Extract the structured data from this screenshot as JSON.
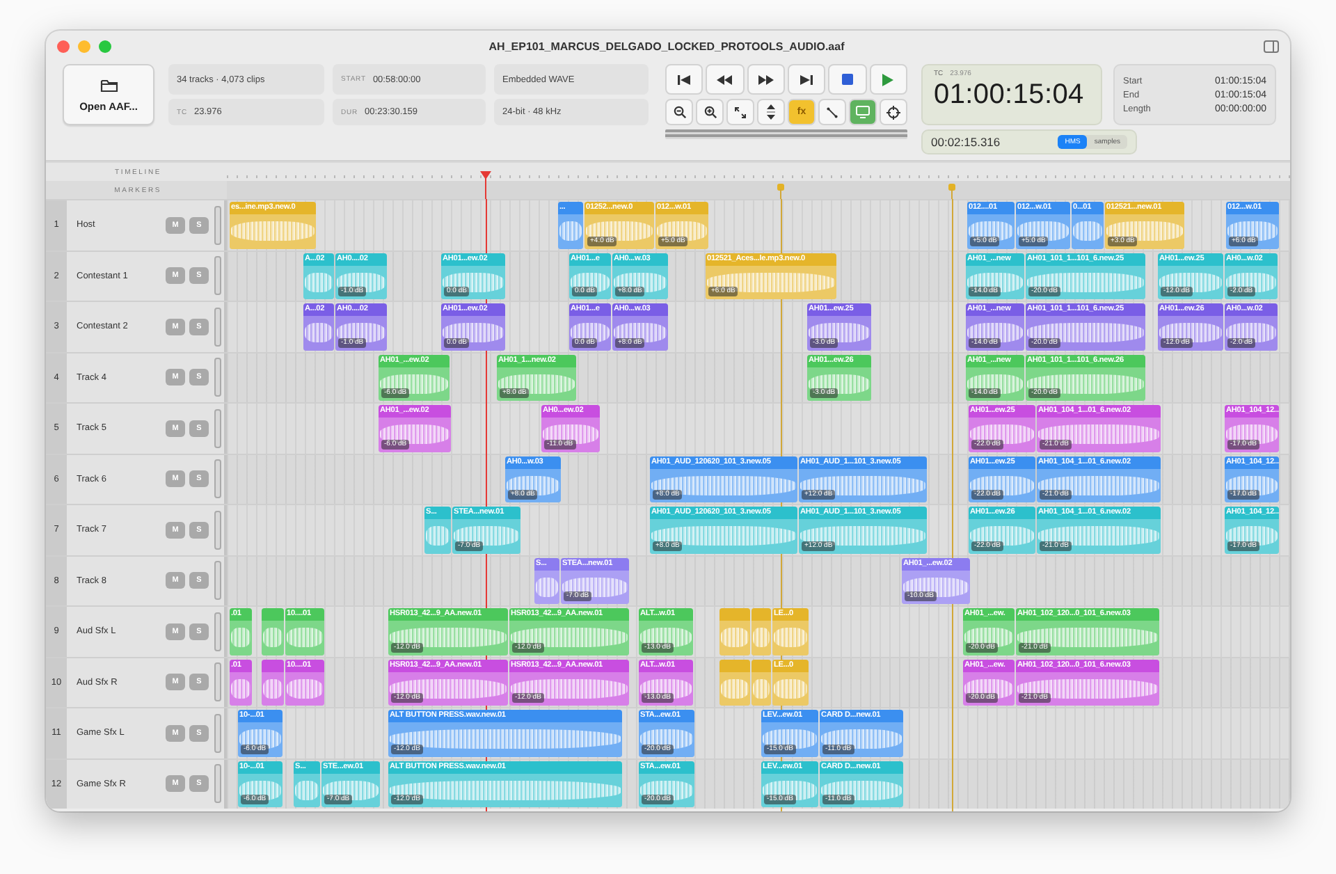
{
  "window": {
    "title": "AH_EP101_MARCUS_DELGADO_LOCKED_PROTOOLS_AUDIO.aaf"
  },
  "toolbar": {
    "open_button": "Open AAF...",
    "info": [
      {
        "value": "34 tracks · 4,073 clips"
      },
      {
        "label": "START",
        "value": "00:58:00:00"
      },
      {
        "value": "Embedded WAVE"
      },
      {
        "label": "TC",
        "value": "23.976"
      },
      {
        "label": "DUR",
        "value": "00:23:30.159"
      },
      {
        "value": "24-bit · 48 kHz"
      }
    ],
    "transport": [
      {
        "kind": "skip-back"
      },
      {
        "kind": "rewind"
      },
      {
        "kind": "fast-forward"
      },
      {
        "kind": "skip-forward"
      },
      {
        "kind": "stop"
      },
      {
        "kind": "play"
      }
    ],
    "tools": [
      {
        "kind": "zoom-out",
        "selected": false
      },
      {
        "kind": "zoom-in",
        "selected": false
      },
      {
        "kind": "expand",
        "selected": false
      },
      {
        "kind": "up-down",
        "selected": false
      },
      {
        "kind": "fx",
        "label": "fx",
        "selected": true,
        "color": "#f2c12e"
      },
      {
        "kind": "link",
        "selected": false
      },
      {
        "kind": "monitor",
        "selected": true,
        "color": "#5fb35f"
      },
      {
        "kind": "crosshair",
        "selected": false
      }
    ],
    "timecode": {
      "rate_label": "TC",
      "rate": "23.976",
      "value": "01:00:15:04",
      "elapsed": "00:02:15.316",
      "modes": [
        {
          "label": "HMS",
          "selected": true
        },
        {
          "label": "samples",
          "selected": false
        }
      ]
    },
    "selection": [
      {
        "label": "Start",
        "value": "01:00:15:04"
      },
      {
        "label": "End",
        "value": "01:00:15:04"
      },
      {
        "label": "Length",
        "value": "00:00:00:00"
      }
    ]
  },
  "ruler": {
    "timeline_label": "TIMELINE",
    "markers_label": "MARKERS"
  },
  "tracks": [
    {
      "number": "1",
      "name": "Host",
      "mute": "M",
      "solo": "S",
      "clips": [
        {
          "name": "es...ine.mp3.new.0",
          "color": "#e5b52a"
        },
        {
          "name": "...",
          "color": "#3b8ff0"
        },
        {
          "name": "01252...new.0",
          "gain": "+4.0 dB",
          "color": "#e5b52a"
        },
        {
          "name": "012...w.01",
          "gain": "+5.0 dB",
          "color": "#e5b52a"
        },
        {
          "name": "012....01",
          "gain": "+5.0 dB",
          "color": "#3b8ff0"
        },
        {
          "name": "012...w.01",
          "gain": "+5.0 dB",
          "color": "#3b8ff0"
        },
        {
          "name": "0...01",
          "color": "#3b8ff0"
        },
        {
          "name": "012521...new.01",
          "gain": "+3.0 dB",
          "color": "#e5b52a"
        },
        {
          "name": "012...w.01",
          "gain": "+6.0 dB",
          "color": "#3b8ff0"
        }
      ]
    },
    {
      "number": "2",
      "name": "Contestant 1",
      "mute": "M",
      "solo": "S",
      "clips": [
        {
          "name": "A...02",
          "color": "#2cc0cc"
        },
        {
          "name": "AH0....02",
          "gain": "-1.0 dB",
          "color": "#2cc0cc"
        },
        {
          "name": "AH01...ew.02",
          "gain": "0.0 dB",
          "color": "#2cc0cc"
        },
        {
          "name": "AH01...e",
          "gain": "0.0 dB",
          "color": "#2cc0cc"
        },
        {
          "name": "AH0...w.03",
          "gain": "+8.0 dB",
          "color": "#2cc0cc"
        },
        {
          "name": "012521_Aces...le.mp3.new.0",
          "gain": "+6.0 dB",
          "color": "#e5b52a"
        },
        {
          "name": "AH01_...new",
          "gain": "-14.0 dB",
          "color": "#2cc0cc"
        },
        {
          "name": "AH01_101_1...101_6.new.25",
          "gain": "-20.0 dB",
          "color": "#2cc0cc"
        },
        {
          "name": "AH01...ew.25",
          "gain": "-12.0 dB",
          "color": "#2cc0cc"
        },
        {
          "name": "AH0...w.02",
          "gain": "-2.0 dB",
          "color": "#2cc0cc"
        }
      ]
    },
    {
      "number": "3",
      "name": "Contestant 2",
      "mute": "M",
      "solo": "S",
      "clips": [
        {
          "name": "A...02",
          "color": "#7a5ee6"
        },
        {
          "name": "AH0....02",
          "gain": "-1.0 dB",
          "color": "#7a5ee6"
        },
        {
          "name": "AH01...ew.02",
          "gain": "0.0 dB",
          "color": "#7a5ee6"
        },
        {
          "name": "AH01...e",
          "gain": "0.0 dB",
          "color": "#7a5ee6"
        },
        {
          "name": "AH0...w.03",
          "gain": "+8.0 dB",
          "color": "#7a5ee6"
        },
        {
          "name": "AH01...ew.25",
          "gain": "-3.0 dB",
          "color": "#7a5ee6"
        },
        {
          "name": "AH01_...new",
          "gain": "-14.0 dB",
          "color": "#7a5ee6"
        },
        {
          "name": "AH01_101_1...101_6.new.25",
          "gain": "-20.0 dB",
          "color": "#7a5ee6"
        },
        {
          "name": "AH01...ew.26",
          "gain": "-12.0 dB",
          "color": "#7a5ee6"
        },
        {
          "name": "AH0...w.02",
          "gain": "-2.0 dB",
          "color": "#7a5ee6"
        }
      ]
    },
    {
      "number": "4",
      "name": "Track 4",
      "mute": "M",
      "solo": "S",
      "clips": [
        {
          "name": "AH01_...ew.02",
          "gain": "-6.0 dB",
          "color": "#4cc85c"
        },
        {
          "name": "AH01_1...new.02",
          "gain": "+8.0 dB",
          "color": "#4cc85c"
        },
        {
          "name": "AH01...ew.26",
          "gain": "-3.0 dB",
          "color": "#4cc85c"
        },
        {
          "name": "AH01_...new",
          "gain": "-14.0 dB",
          "color": "#4cc85c"
        },
        {
          "name": "AH01_101_1...101_6.new.26",
          "gain": "-20.0 dB",
          "color": "#4cc85c"
        }
      ]
    },
    {
      "number": "5",
      "name": "Track 5",
      "mute": "M",
      "solo": "S",
      "clips": [
        {
          "name": "AH01_...ew.02",
          "gain": "-6.0 dB",
          "color": "#c84ee0"
        },
        {
          "name": "AH0...ew.02",
          "gain": "-11.0 dB",
          "color": "#c84ee0"
        },
        {
          "name": "AH01...ew.25",
          "gain": "-22.0 dB",
          "color": "#c84ee0"
        },
        {
          "name": "AH01_104_1...01_6.new.02",
          "gain": "-21.0 dB",
          "color": "#c84ee0"
        },
        {
          "name": "AH01_104_12...",
          "gain": "-17.0 dB",
          "color": "#c84ee0"
        }
      ]
    },
    {
      "number": "6",
      "name": "Track 6",
      "mute": "M",
      "solo": "S",
      "clips": [
        {
          "name": "AH0...w.03",
          "gain": "+8.0 dB",
          "color": "#3b8ff0"
        },
        {
          "name": "AH01_AUD_120620_101_3.new.05",
          "gain": "+8.0 dB",
          "color": "#3b8ff0"
        },
        {
          "name": "AH01_AUD_1...101_3.new.05",
          "gain": "+12.0 dB",
          "color": "#3b8ff0"
        },
        {
          "name": "AH01...ew.25",
          "gain": "-22.0 dB",
          "color": "#3b8ff0"
        },
        {
          "name": "AH01_104_1...01_6.new.02",
          "gain": "-21.0 dB",
          "color": "#3b8ff0"
        },
        {
          "name": "AH01_104_12...",
          "gain": "-17.0 dB",
          "color": "#3b8ff0"
        }
      ]
    },
    {
      "number": "7",
      "name": "Track 7",
      "mute": "M",
      "solo": "S",
      "clips": [
        {
          "name": "S...",
          "color": "#2cc0cc"
        },
        {
          "name": "STEA...new.01",
          "gain": "-7.0 dB",
          "color": "#2cc0cc"
        },
        {
          "name": "AH01_AUD_120620_101_3.new.05",
          "gain": "+8.0 dB",
          "color": "#2cc0cc"
        },
        {
          "name": "AH01_AUD_1...101_3.new.05",
          "gain": "+12.0 dB",
          "color": "#2cc0cc"
        },
        {
          "name": "AH01...ew.26",
          "gain": "-22.0 dB",
          "color": "#2cc0cc"
        },
        {
          "name": "AH01_104_1...01_6.new.02",
          "gain": "-21.0 dB",
          "color": "#2cc0cc"
        },
        {
          "name": "AH01_104_12...",
          "gain": "-17.0 dB",
          "color": "#2cc0cc"
        }
      ]
    },
    {
      "number": "8",
      "name": "Track 8",
      "mute": "M",
      "solo": "S",
      "clips": [
        {
          "name": "S...",
          "color": "#8c7cf0"
        },
        {
          "name": "STEA...new.01",
          "gain": "-7.0 dB",
          "color": "#8c7cf0"
        },
        {
          "name": "AH01_...ew.02",
          "gain": "-10.0 dB",
          "color": "#8c7cf0"
        }
      ]
    },
    {
      "number": "9",
      "name": "Aud Sfx L",
      "mute": "M",
      "solo": "S",
      "clips": [
        {
          "name": ".01",
          "color": "#4cc85c"
        },
        {
          "color": "#4cc85c"
        },
        {
          "name": "10....01",
          "color": "#4cc85c"
        },
        {
          "name": "HSR013_42...9_AA.new.01",
          "gain": "-12.0 dB",
          "color": "#4cc85c"
        },
        {
          "name": "HSR013_42...9_AA.new.01",
          "gain": "-12.0 dB",
          "color": "#4cc85c"
        },
        {
          "name": "ALT...w.01",
          "gain": "-13.0 dB",
          "color": "#4cc85c"
        },
        {
          "color": "#e5b52a"
        },
        {
          "color": "#e5b52a"
        },
        {
          "name": "LE...0",
          "color": "#e5b52a"
        },
        {
          "name": "AH01_...ew.",
          "gain": "-20.0 dB",
          "color": "#4cc85c"
        },
        {
          "name": "AH01_102_120...0_101_6.new.03",
          "gain": "-21.0 dB",
          "color": "#4cc85c"
        }
      ]
    },
    {
      "number": "10",
      "name": "Aud Sfx R",
      "mute": "M",
      "solo": "S",
      "clips": [
        {
          "name": ".01",
          "color": "#c84ee0"
        },
        {
          "color": "#c84ee0"
        },
        {
          "name": "10....01",
          "color": "#c84ee0"
        },
        {
          "name": "HSR013_42...9_AA.new.01",
          "gain": "-12.0 dB",
          "color": "#c84ee0"
        },
        {
          "name": "HSR013_42...9_AA.new.01",
          "gain": "-12.0 dB",
          "color": "#c84ee0"
        },
        {
          "name": "ALT...w.01",
          "gain": "-13.0 dB",
          "color": "#c84ee0"
        },
        {
          "color": "#e5b52a"
        },
        {
          "color": "#e5b52a"
        },
        {
          "name": "LE...0",
          "color": "#e5b52a"
        },
        {
          "name": "AH01_...ew.",
          "gain": "-20.0 dB",
          "color": "#c84ee0"
        },
        {
          "name": "AH01_102_120...0_101_6.new.03",
          "gain": "-21.0 dB",
          "color": "#c84ee0"
        }
      ]
    },
    {
      "number": "11",
      "name": "Game Sfx L",
      "mute": "M",
      "solo": "S",
      "clips": [
        {
          "name": "10-...01",
          "gain": "-6.0 dB",
          "color": "#3b8ff0"
        },
        {
          "name": "ALT BUTTON PRESS.wav.new.01",
          "gain": "-12.0 dB",
          "color": "#3b8ff0"
        },
        {
          "name": "STA...ew.01",
          "gain": "-20.0 dB",
          "color": "#3b8ff0"
        },
        {
          "name": "LEV...ew.01",
          "gain": "-15.0 dB",
          "color": "#3b8ff0"
        },
        {
          "name": "CARD D...new.01",
          "gain": "-11.0 dB",
          "color": "#3b8ff0"
        }
      ]
    },
    {
      "number": "12",
      "name": "Game Sfx R",
      "mute": "M",
      "solo": "S",
      "clips": [
        {
          "name": "10-...01",
          "gain": "-6.0 dB",
          "color": "#2cc0cc"
        },
        {
          "name": "S...",
          "color": "#2cc0cc"
        },
        {
          "name": "STE...ew.01",
          "gain": "-7.0 dB",
          "color": "#2cc0cc"
        },
        {
          "name": "ALT BUTTON PRESS.wav.new.01",
          "gain": "-12.0 dB",
          "color": "#2cc0cc"
        },
        {
          "name": "STA...ew.01",
          "gain": "-20.0 dB",
          "color": "#2cc0cc"
        },
        {
          "name": "LEV...ew.01",
          "gain": "-15.0 dB",
          "color": "#2cc0cc"
        },
        {
          "name": "CARD D...new.01",
          "gain": "-11.0 dB",
          "color": "#2cc0cc"
        }
      ]
    }
  ]
}
